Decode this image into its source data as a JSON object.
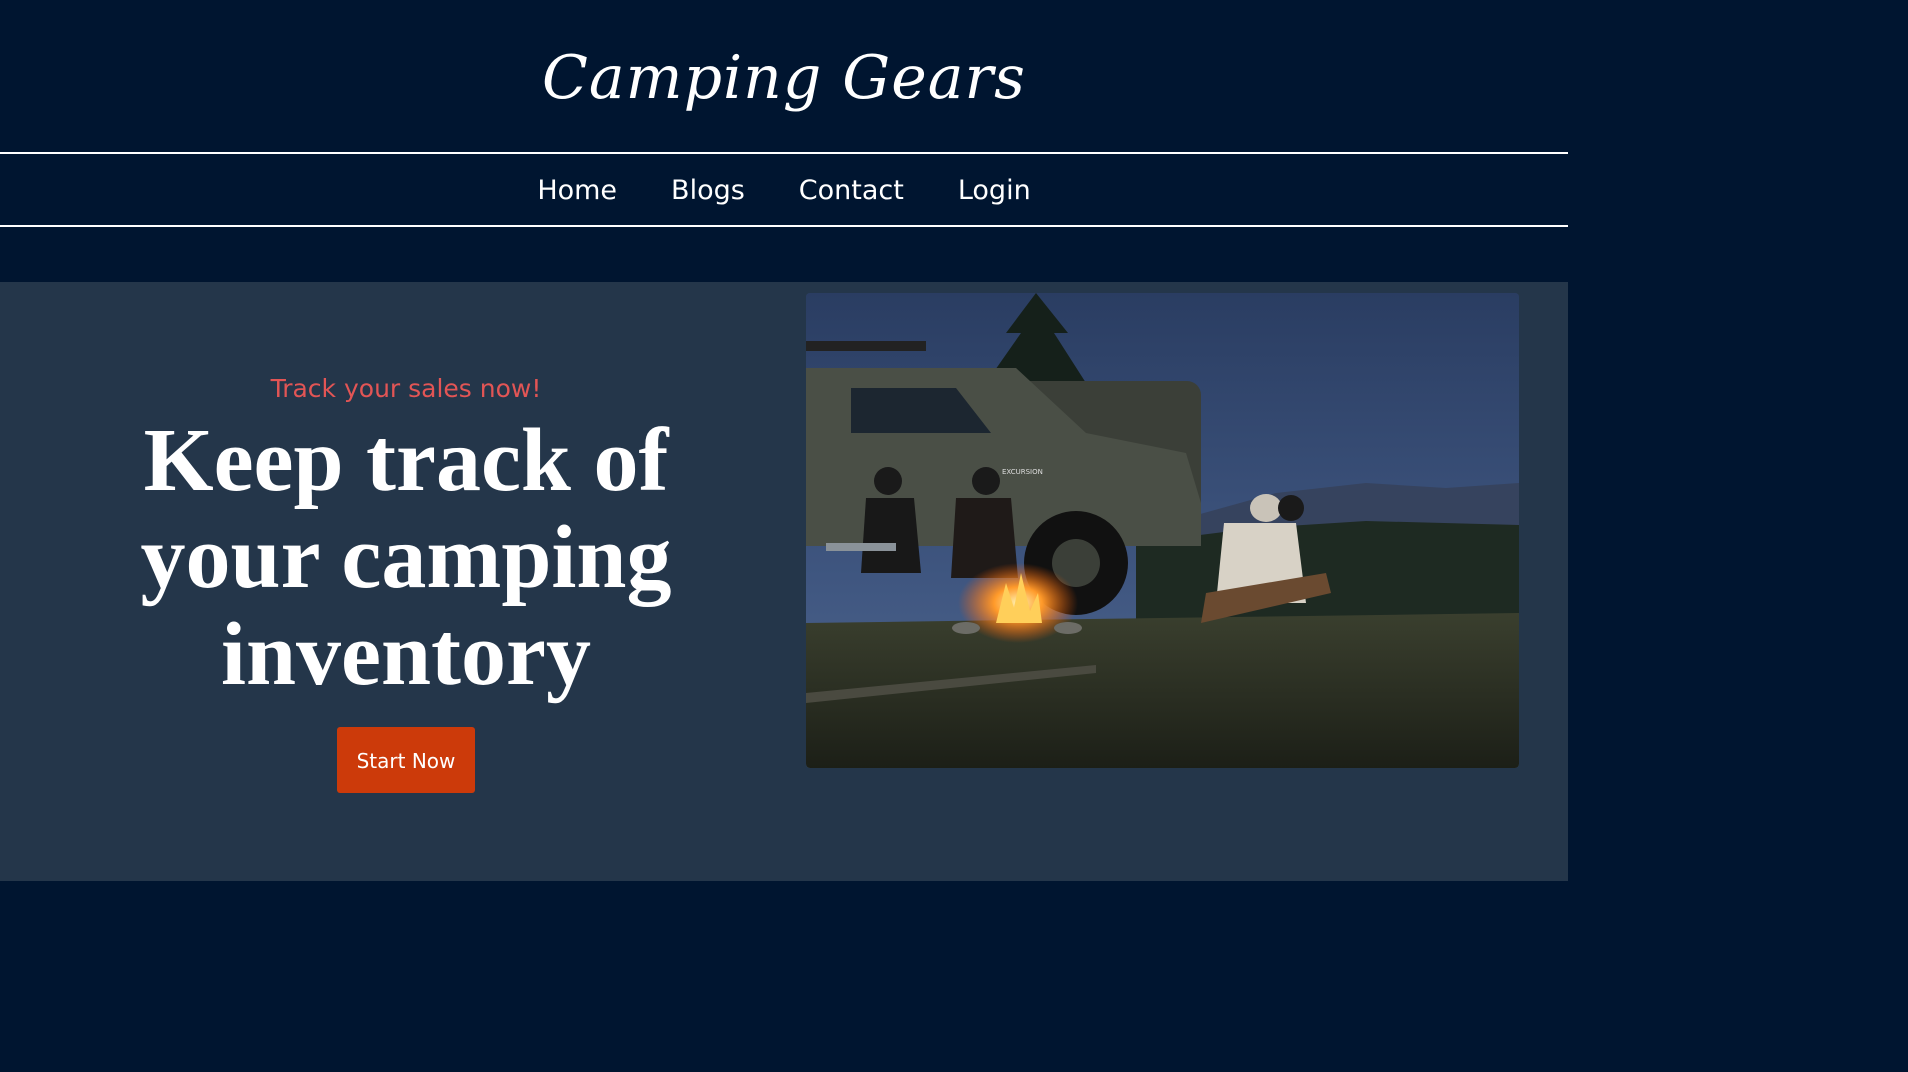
{
  "header": {
    "brand": "Camping Gears"
  },
  "nav": {
    "items": [
      {
        "label": "Home"
      },
      {
        "label": "Blogs"
      },
      {
        "label": "Contact"
      },
      {
        "label": "Login"
      }
    ]
  },
  "hero": {
    "tagline": "Track your sales now!",
    "headline": "Keep track of your camping inventory",
    "cta_label": "Start Now",
    "image_truck_badge": "EXCURSION"
  },
  "colors": {
    "header_bg": "#001530",
    "hero_bg": "#24364a",
    "tagline": "#e25555",
    "cta_bg": "#cc3a0a",
    "text": "#ffffff"
  }
}
